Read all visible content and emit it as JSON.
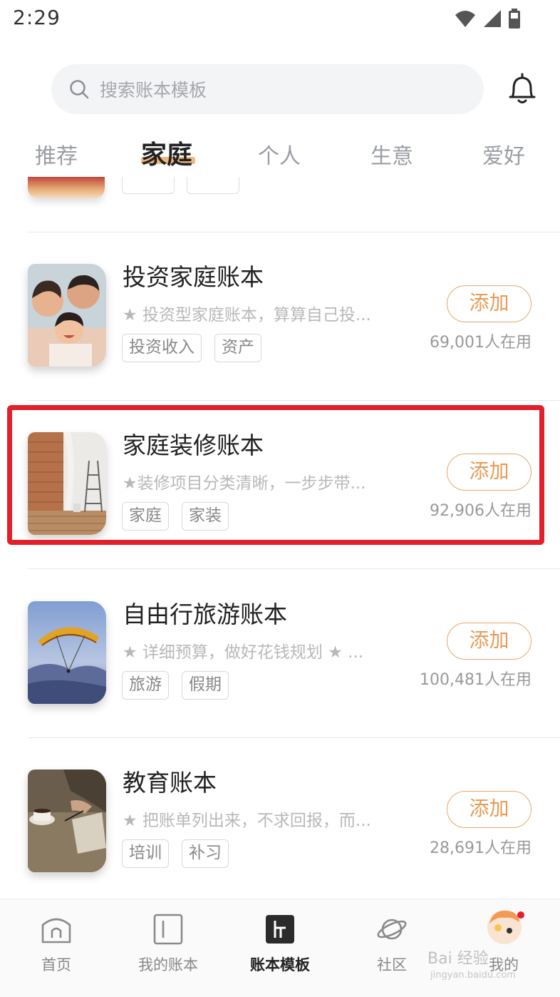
{
  "status_bar": {
    "time": "2:29"
  },
  "search": {
    "placeholder": "搜索账本模板"
  },
  "tabs": [
    {
      "label": "推荐"
    },
    {
      "label": "家庭",
      "active": true
    },
    {
      "label": "个人"
    },
    {
      "label": "生意"
    },
    {
      "label": "爱好"
    }
  ],
  "templates": [
    {
      "title": "投资家庭账本",
      "description": "★ 投资型家庭账本，算算自己投...",
      "tags": [
        "投资收入",
        "资产"
      ],
      "add_label": "添加",
      "users": "69,001人在用",
      "image": "family-photo"
    },
    {
      "title": "家庭装修账本",
      "description": "★装修项目分类清晰，一步步带...",
      "tags": [
        "家庭",
        "家装"
      ],
      "add_label": "添加",
      "users": "92,906人在用",
      "image": "renovation-photo",
      "highlighted": true
    },
    {
      "title": "自由行旅游账本",
      "description": "★ 详细预算，做好花钱规划 ★ ...",
      "tags": [
        "旅游",
        "假期"
      ],
      "add_label": "添加",
      "users": "100,481人在用",
      "image": "paraglider-photo"
    },
    {
      "title": "教育账本",
      "description": "★ 把账单列出来，不求回报，而...",
      "tags": [
        "培训",
        "补习"
      ],
      "add_label": "添加",
      "users": "28,691人在用",
      "image": "study-photo"
    }
  ],
  "bottom_nav": [
    {
      "label": "首页",
      "icon": "home-icon"
    },
    {
      "label": "我的账本",
      "icon": "book-icon"
    },
    {
      "label": "账本模板",
      "icon": "template-icon",
      "active": true
    },
    {
      "label": "社区",
      "icon": "planet-icon"
    },
    {
      "label": "我的",
      "icon": "avatar-icon"
    }
  ],
  "watermark": {
    "brand": "Bai 经验",
    "url": "jingyan.baidu.com"
  },
  "colors": {
    "accent": "#ea9a55",
    "highlight": "#e3202a",
    "tab_underline": "#f1b87d"
  }
}
